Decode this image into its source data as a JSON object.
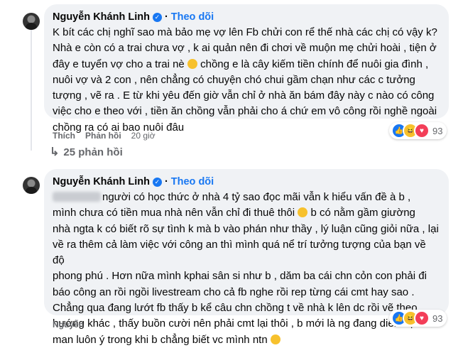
{
  "comments": [
    {
      "author": "Nguyễn Khánh Linh",
      "verified": true,
      "separator": "·",
      "follow_label": "Theo dõi",
      "lines": [
        "K bít các chị nghĩ sao mà bảo mẹ vợ lên Fb chửi con rể thế nhà các chị có vậy k?",
        "Nhà e còn có a trai chưa vợ , k ai quản nên đi chơi về muộn mẹ chửi hoài , tiện ở",
        "nuôi vợ và 2 con , nên chẳng có chuyện chó chui gầm chạn như các c tưởng",
        "tượng , vẽ ra . E từ khi yêu đến giờ vẫn chỉ ở nhà ăn bám đây này c nào có công",
        "việc cho e theo với , tiền ăn chồng vẫn phải cho á chứ em vô công rồi nghề ngoài",
        "chồng ra có ai bao nuôi đâu"
      ],
      "line3_start": "đây e tuyển vợ cho a trai nè",
      "line3_end": "chồng e là cây kiếm tiền chính để nuôi gia đình ,",
      "actions": {
        "like": "Thích",
        "reply": "Phản hồi",
        "time": "20 giờ"
      },
      "reaction_count": "93",
      "reaction_icons": [
        "like-icon",
        "haha-icon",
        "love-icon"
      ]
    },
    {
      "author": "Nguyễn Khánh Linh",
      "verified": true,
      "separator": "·",
      "follow_label": "Theo dõi",
      "line1": "người có học thức ở nhà 4 tỷ sao đọc mãi vẫn k hiểu vấn đề à b ,",
      "line2_start": "mình chưa có tiền mua nhà nên vẫn chỉ đi thuê thôi",
      "line2_end": "b có nằm gầm giường",
      "lines": [
        "nhà ngta k có biết rõ sự tình k mà b vào phán như thầy , lý luận cũng giỏi nữa , lại",
        "về ra thêm cả làm việc với công an thì mình quá nể trí tưởng tượng của bạn về độ",
        "phong phú . Hơn nữa mình kphai sân si như b , dăm ba cái chn cỏn con phải đi",
        "báo công an rồi ngồi livestream cho cả fb nghe rồi rep từng cái cmt hay sao .",
        "Chẳng qua đang lướt fb thấy b kể câu chn chồng t về nhà k lên dc rồi vẽ theo",
        "hướng khác , thấy buồn cười nên phải cmt lại thôi , b mới là ng đang diễn đạt dã"
      ],
      "line_last": "man luôn ý trong khi b chẳng biết vc mình ntn",
      "reaction_count": "93",
      "reaction_icons": [
        "like-icon",
        "haha-icon",
        "love-icon"
      ],
      "footer_name": "Nguyễn"
    }
  ],
  "replies_label": "25 phản hồi",
  "colors": {
    "accent": "#1877f2",
    "bubble": "#f0f2f5",
    "muted": "#65676b"
  }
}
